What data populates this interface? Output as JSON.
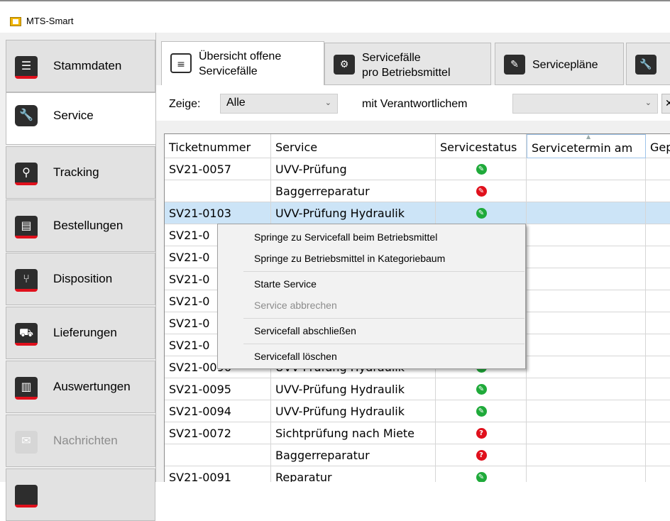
{
  "window": {
    "title": "MTS-Smart"
  },
  "nav": {
    "items": [
      {
        "label": "Stammdaten",
        "icon": "list-icon"
      },
      {
        "label": "Service",
        "icon": "wrench-icon",
        "active": true
      },
      {
        "label": "Tracking",
        "icon": "map-pin-icon"
      },
      {
        "label": "Bestellungen",
        "icon": "clipboard-cart-icon"
      },
      {
        "label": "Disposition",
        "icon": "dispatch-icon"
      },
      {
        "label": "Lieferungen",
        "icon": "truck-icon"
      },
      {
        "label": "Auswertungen",
        "icon": "bar-chart-icon"
      },
      {
        "label": "Nachrichten",
        "icon": "envelope-icon",
        "disabled": true
      }
    ]
  },
  "tabs": [
    {
      "label": "Übersicht offene\nServicefälle",
      "icon": "service-overview-icon",
      "active": true
    },
    {
      "label": "Servicefälle\npro Betriebsmittel",
      "icon": "service-machine-icon"
    },
    {
      "label": "Servicepläne",
      "icon": "service-plan-icon"
    },
    {
      "label": "",
      "icon": "wrench-icon"
    }
  ],
  "filter": {
    "show_label": "Zeige:",
    "show_value": "Alle",
    "responsible_label": "mit Verantwortlichem",
    "responsible_value": "",
    "clear_label": "✕"
  },
  "grid": {
    "columns": [
      "Ticketnummer",
      "Service",
      "Servicestatus",
      "Servicetermin am",
      "Gep"
    ],
    "sorted_column": "Servicetermin am",
    "rows": [
      {
        "ticket": "SV21-0057",
        "service": "UVV-Prüfung",
        "status": "ok"
      },
      {
        "ticket": "",
        "service": "Baggerreparatur",
        "status": "error"
      },
      {
        "ticket": "SV21-0103",
        "service": "UVV-Prüfung Hydraulik",
        "status": "ok"
      },
      {
        "ticket": "SV21-0",
        "service": "",
        "status": ""
      },
      {
        "ticket": "SV21-0",
        "service": "",
        "status": ""
      },
      {
        "ticket": "SV21-0",
        "service": "",
        "status": ""
      },
      {
        "ticket": "SV21-0",
        "service": "",
        "status": ""
      },
      {
        "ticket": "SV21-0",
        "service": "",
        "status": ""
      },
      {
        "ticket": "SV21-0",
        "service": "",
        "status": ""
      },
      {
        "ticket": "SV21-0096",
        "service": "UVV-Prüfung Hydraulik",
        "status": "ok"
      },
      {
        "ticket": "SV21-0095",
        "service": "UVV-Prüfung Hydraulik",
        "status": "ok"
      },
      {
        "ticket": "SV21-0094",
        "service": "UVV-Prüfung Hydraulik",
        "status": "ok"
      },
      {
        "ticket": "SV21-0072",
        "service": "Sichtprüfung nach Miete",
        "status": "unknown"
      },
      {
        "ticket": "",
        "service": "Baggerreparatur",
        "status": "unknown"
      },
      {
        "ticket": "SV21-0091",
        "service": "Reparatur",
        "status": "ok"
      }
    ]
  },
  "context_menu": {
    "items": [
      {
        "label": "Springe zu Servicefall beim Betriebsmittel",
        "enabled": true
      },
      {
        "label": "Springe zu Betriebsmittel in Kategoriebaum",
        "enabled": true
      },
      {
        "label": "Starte Service",
        "enabled": true
      },
      {
        "label": "Service abbrechen",
        "enabled": false
      },
      {
        "label": "Servicefall abschließen",
        "enabled": true
      },
      {
        "label": "Servicefall löschen",
        "enabled": true
      }
    ]
  },
  "colors": {
    "accent_red": "#e0101c",
    "status_ok": "#1faa3a",
    "status_error": "#e0101c",
    "selection": "#cce4f7"
  }
}
